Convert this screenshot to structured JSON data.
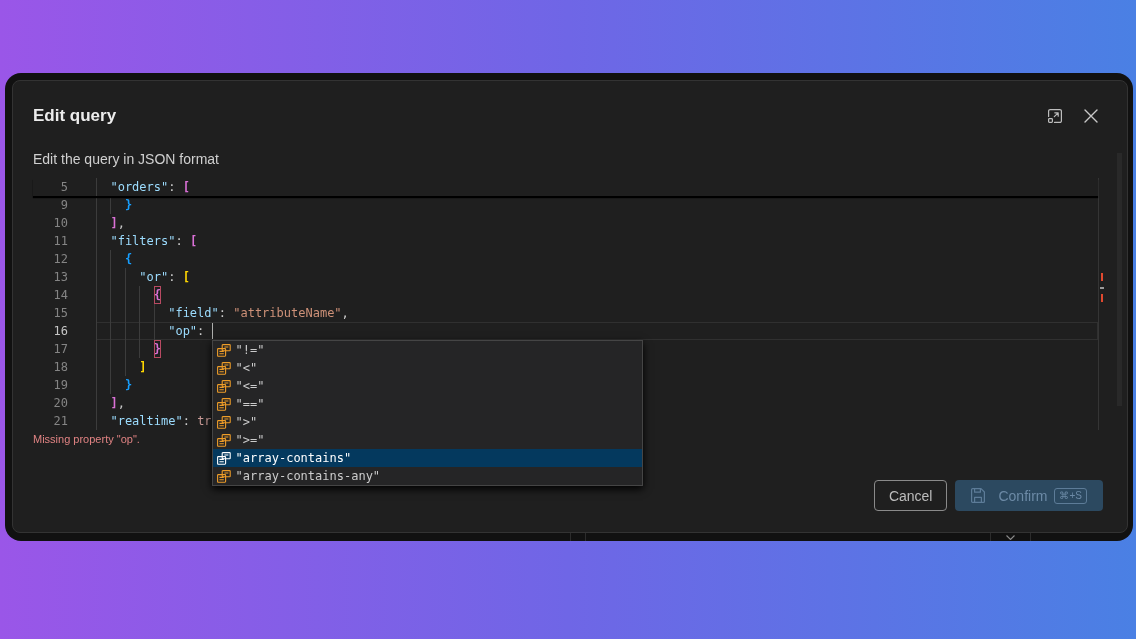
{
  "dialog": {
    "title": "Edit query",
    "description": "Edit the query in JSON format"
  },
  "editor": {
    "sticky_line": {
      "number": "5",
      "tokens": [
        {
          "kind": "key",
          "text": "\"orders\""
        },
        {
          "kind": "punct",
          "text": ": "
        },
        {
          "kind": "bracket",
          "text": "[",
          "color": "#da70d6",
          "highlighted": false
        }
      ],
      "children": [
        {
          "number": "9",
          "current": false,
          "tokens": [
            {
              "kind": "bracket",
              "text": "}",
              "color": "#179fff",
              "highlighted": false
            }
          ]
        }
      ]
    },
    "lines": [
      {
        "number": "10",
        "current": false,
        "tokens": [
          {
            "kind": "bracket",
            "text": "]",
            "color": "#da70d6",
            "highlighted": false
          },
          {
            "kind": "punct",
            "text": ","
          }
        ]
      },
      {
        "number": "11",
        "current": false,
        "tokens": [
          {
            "kind": "key",
            "text": "\"filters\""
          },
          {
            "kind": "punct",
            "text": ": "
          },
          {
            "kind": "bracket",
            "text": "[",
            "color": "#da70d6",
            "highlighted": false
          }
        ],
        "children": [
          {
            "number": "12",
            "current": false,
            "tokens": [
              {
                "kind": "bracket",
                "text": "{",
                "color": "#179fff",
                "highlighted": false
              }
            ],
            "children": [
              {
                "number": "13",
                "current": false,
                "tokens": [
                  {
                    "kind": "key",
                    "text": "\"or\""
                  },
                  {
                    "kind": "punct",
                    "text": ": "
                  },
                  {
                    "kind": "bracket",
                    "text": "[",
                    "color": "#ffd700",
                    "highlighted": false
                  }
                ],
                "children": [
                  {
                    "number": "14",
                    "current": false,
                    "tokens": [
                      {
                        "kind": "bracket",
                        "text": "{",
                        "color": "#da70d6",
                        "highlighted": true
                      }
                    ],
                    "children": [
                      {
                        "number": "15",
                        "current": false,
                        "tokens": [
                          {
                            "kind": "key",
                            "text": "\"field\""
                          },
                          {
                            "kind": "punct",
                            "text": ": "
                          },
                          {
                            "kind": "string",
                            "text": "\"attributeName\""
                          },
                          {
                            "kind": "punct",
                            "text": ","
                          }
                        ]
                      },
                      {
                        "number": "16",
                        "current": true,
                        "tokens": [
                          {
                            "kind": "key",
                            "text": "\"op\""
                          },
                          {
                            "kind": "punct",
                            "text": ": "
                          }
                        ]
                      }
                    ]
                  },
                  {
                    "number": "17",
                    "current": false,
                    "tokens": [
                      {
                        "kind": "bracket",
                        "text": "}",
                        "color": "#da70d6",
                        "highlighted": true
                      }
                    ]
                  }
                ]
              },
              {
                "number": "18",
                "current": false,
                "tokens": [
                  {
                    "kind": "bracket",
                    "text": "]",
                    "color": "#ffd700",
                    "highlighted": false
                  }
                ]
              }
            ]
          },
          {
            "number": "19",
            "current": false,
            "tokens": [
              {
                "kind": "bracket",
                "text": "}",
                "color": "#179fff",
                "highlighted": false
              }
            ]
          }
        ]
      },
      {
        "number": "20",
        "current": false,
        "tokens": [
          {
            "kind": "bracket",
            "text": "]",
            "color": "#da70d6",
            "highlighted": false
          },
          {
            "kind": "punct",
            "text": ","
          }
        ]
      },
      {
        "number": "21",
        "current": false,
        "tokens": [
          {
            "kind": "key",
            "text": "\"realtime\""
          },
          {
            "kind": "punct",
            "text": ": "
          },
          {
            "kind": "literal",
            "text": "tr"
          }
        ]
      }
    ],
    "suggestions": [
      {
        "label": "\"!=\"",
        "selected": false
      },
      {
        "label": "\"<\"",
        "selected": false
      },
      {
        "label": "\"<=\"",
        "selected": false
      },
      {
        "label": "\"==\"",
        "selected": false
      },
      {
        "label": "\">\"",
        "selected": false
      },
      {
        "label": "\">=\"",
        "selected": false
      },
      {
        "label": "\"array-contains\"",
        "selected": true
      },
      {
        "label": "\"array-contains-any\"",
        "selected": false
      }
    ],
    "error": "Missing property \"op\"."
  },
  "buttons": [
    {
      "label": "Cancel",
      "kind": "secondary",
      "disabled": false
    },
    {
      "label": "Confirm",
      "kind": "primary",
      "disabled": true,
      "shortcut": "⌘+S"
    }
  ]
}
